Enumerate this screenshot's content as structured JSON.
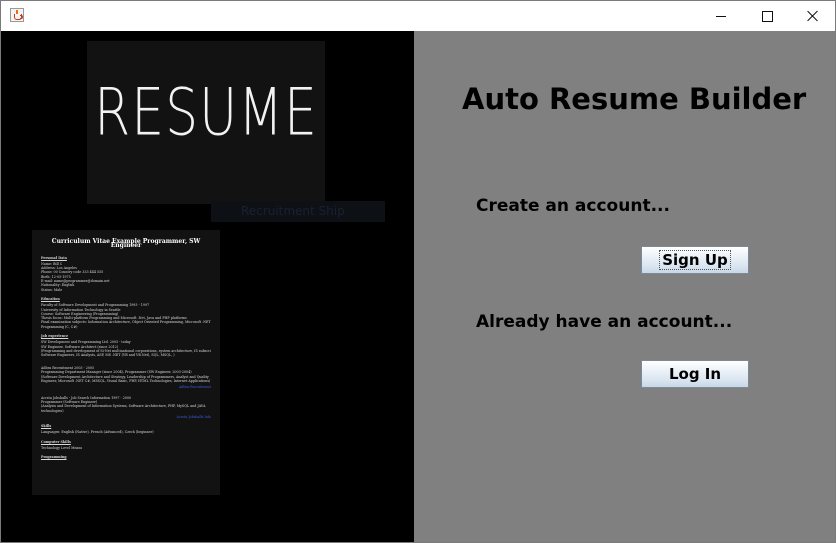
{
  "window": {
    "controls": {
      "minimize": "minimize-icon",
      "maximize": "maximize-icon",
      "close": "close-icon"
    },
    "app_icon": "java-cup-icon"
  },
  "left": {
    "banner_word": "RESUME",
    "banner_strip_text": "Recruitment Ship",
    "cv": {
      "title": "Curriculum Vitae Example Programmer, SW Engineer",
      "sections": [
        {
          "heading": "Personal Data",
          "lines": [
            "Name: Bill C",
            "Address: Los Angeles",
            "Phone: 00 Country code 333 444 555",
            "Birth: 12-05-1975",
            "E-mail: name@programmer@domain.net",
            "Nationality: English",
            "Status: Male"
          ]
        },
        {
          "heading": "Education",
          "lines": [
            "Faculty of Software Development and Programming 1993 - 1997",
            "University of Information Technology in Seattle",
            "Course: Software Engineering (Programming)",
            "Thesis focus: Multi-platform Programming and Microsoft .Net, Java and PHP platforms",
            "Final examination subjects: Information Architecture, Object Oriented Programming, Microsoft .NET",
            "Programming (C, C#)"
          ]
        },
        {
          "heading": "Job experience",
          "lines": [
            "SW Development and Programming Ltd. 2005 - today",
            "SW Engineer, Software Architect (since 2012)",
            "(Programming and development of Si-Net multinational corporations, system architecture, IS subscriptions;",
            "Software Engineers, IS Analysts, ASP, MS .NET (VB and VB.Net), SQL, MSQL, )",
            "",
            "",
            "Adbra Recruitment 2003 - 2005",
            "Programming Department Manager (since 2004), Programmer (SW Engineer, 2003-2004)",
            "(Software Development Architecture and Strategy, Leadership of Programmers, Analyst and Quality",
            "Engineer, Microsoft .NET C#, MSSQL, Visual Basic, PHP, HTML Technologies, Internet Applications)"
          ]
        },
        {
          "heading": "",
          "lines": [
            "Acrsta Jobshalls - Job Search Information 1997 - 2000",
            "Programmer (Software Engineer)",
            "(Analysis and Development of Information Systems, Software Architecture, PHP, MySQL and JAVA",
            "technologies)"
          ]
        },
        {
          "heading": "Skills",
          "lines": [
            "Languages: English (Native), French (Advanced), Czech (beginner)"
          ]
        },
        {
          "heading": "Computer Skills",
          "lines": [
            "Technology                         Level          Means"
          ]
        },
        {
          "heading": "Programming",
          "lines": []
        }
      ],
      "links": [
        "Adbra-Recruitment",
        "Acrsta Jobshalls Info"
      ]
    }
  },
  "right": {
    "title": "Auto Resume Builder",
    "create_prompt": "Create an account...",
    "signup_label": "Sign Up",
    "login_prompt": "Already have an account...",
    "login_label": "Log In"
  },
  "colors": {
    "left_bg": "#000000",
    "right_bg": "#808080",
    "button_top": "#ffffff",
    "button_bottom": "#c9d7e6"
  }
}
